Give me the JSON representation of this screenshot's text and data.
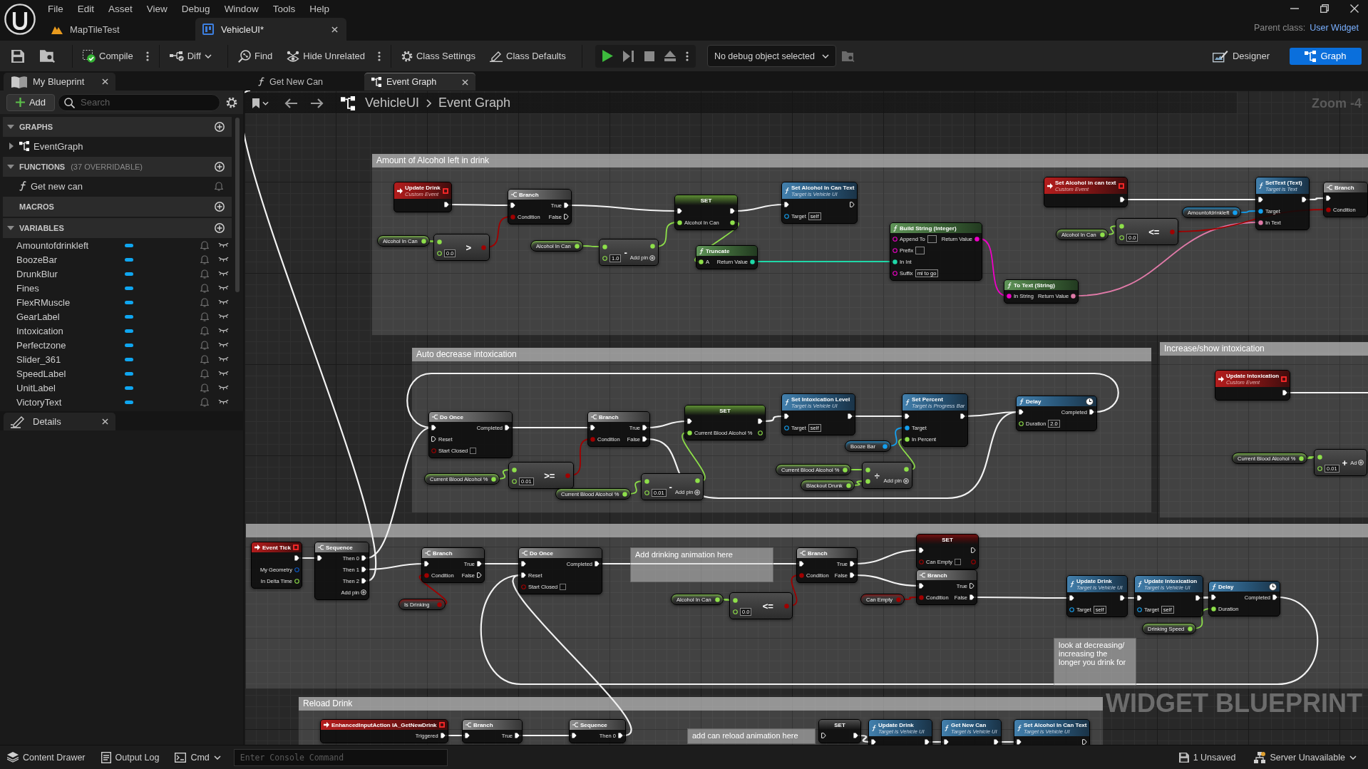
{
  "title_bar": {
    "menu": [
      "File",
      "Edit",
      "Asset",
      "View",
      "Debug",
      "Window",
      "Tools",
      "Help"
    ],
    "tabs": [
      {
        "label": "MapTileTest",
        "kind": "level",
        "selected": false
      },
      {
        "label": "VehicleUI*",
        "kind": "widget",
        "selected": true
      }
    ],
    "parent_class_label": "Parent class:",
    "parent_class": "User Widget"
  },
  "toolbar": {
    "buttons": [
      {
        "kind": "compile",
        "label": "Compile",
        "dropdown": false
      },
      {
        "kind": "diff",
        "label": "Diff",
        "dropdown": true
      },
      {
        "kind": "find",
        "label": "Find",
        "dropdown": false
      },
      {
        "kind": "hide_unrelated",
        "label": "Hide Unrelated",
        "dropdown": false
      },
      {
        "kind": "class_settings",
        "label": "Class Settings",
        "dropdown": false
      },
      {
        "kind": "class_defaults",
        "label": "Class Defaults",
        "dropdown": false
      }
    ],
    "debug_object": "No debug object selected",
    "modes": [
      {
        "kind": "designer",
        "label": "Designer",
        "selected": false
      },
      {
        "kind": "graph",
        "label": "Graph",
        "selected": true
      }
    ]
  },
  "my_blueprint": {
    "tab": "My Blueprint",
    "add": "Add",
    "search_placeholder": "Search",
    "sections": [
      {
        "title": "GRAPHS",
        "expanded": true,
        "items": [
          {
            "label": "EventGraph",
            "kind": "graph",
            "expanded": false
          }
        ]
      },
      {
        "title": "FUNCTIONS",
        "note": "(37 OVERRIDABLE)",
        "expanded": true,
        "items": [
          {
            "label": "Get new can",
            "kind": "function"
          }
        ]
      },
      {
        "title": "MACROS"
      },
      {
        "title": "VARIABLES",
        "expanded": true,
        "items": [
          {
            "label": "Amountofdrinkleft",
            "kind": "variable",
            "public": false
          },
          {
            "label": "BoozeBar",
            "kind": "variable",
            "public": false
          },
          {
            "label": "DrunkBlur",
            "kind": "variable",
            "public": false
          },
          {
            "label": "Fines",
            "kind": "variable",
            "public": false
          },
          {
            "label": "FlexRMuscle",
            "kind": "variable",
            "public": false
          },
          {
            "label": "GearLabel",
            "kind": "variable",
            "public": false
          },
          {
            "label": "Intoxication",
            "kind": "variable",
            "public": false
          },
          {
            "label": "Perfectzone",
            "kind": "variable",
            "public": false
          },
          {
            "label": "Slider_361",
            "kind": "variable",
            "public": false
          },
          {
            "label": "SpeedLabel",
            "kind": "variable",
            "public": false
          },
          {
            "label": "UnitLabel",
            "kind": "variable",
            "public": false
          },
          {
            "label": "VictoryText",
            "kind": "variable",
            "public": false
          }
        ]
      }
    ]
  },
  "details": {
    "tab": "Details"
  },
  "graph_tabs": [
    {
      "label": "Get New Can",
      "kind": "function",
      "selected": false
    },
    {
      "label": "Event Graph",
      "kind": "graph",
      "selected": true
    }
  ],
  "graph": {
    "breadcrumb": [
      "VehicleUI",
      "Event Graph"
    ],
    "zoom": "Zoom -4",
    "watermark": "WIDGET BLUEPRINT",
    "nodes": [
      {
        "kind": "comment",
        "title": "Amount of Alcohol left in drink"
      },
      {
        "kind": "event",
        "title": "Update Drink",
        "subtitle": "Custom Event",
        "outputs": [
          {
            "kind": "exec"
          }
        ]
      },
      {
        "kind": "flow",
        "title": "Branch",
        "inputs": [
          {
            "kind": "exec"
          },
          {
            "kind": "bool",
            "label": "Condition"
          }
        ],
        "outputs": [
          {
            "kind": "exec",
            "label": "True"
          },
          {
            "kind": "exec",
            "label": "False"
          }
        ]
      },
      {
        "kind": "get",
        "title": "Alcohol In Can",
        "outputs": [
          {
            "kind": "float"
          }
        ]
      },
      {
        "kind": "op",
        "title": ">",
        "inputs": [
          {
            "kind": "float"
          },
          {
            "kind": "float",
            "value": "0.0"
          }
        ],
        "outputs": [
          {
            "kind": "bool"
          }
        ]
      },
      {
        "kind": "get",
        "title": "Alcohol In Can",
        "outputs": [
          {
            "kind": "float"
          }
        ]
      },
      {
        "kind": "op",
        "title": "-",
        "inputs": [
          {
            "kind": "float"
          },
          {
            "kind": "float",
            "value": "1.0"
          }
        ],
        "outputs": [
          {
            "kind": "float"
          }
        ],
        "add_pin": "Add pin"
      },
      {
        "kind": "set",
        "title": "SET",
        "inputs": [
          {
            "kind": "exec"
          },
          {
            "kind": "float",
            "label": "Alcohol In Can"
          }
        ],
        "outputs": [
          {
            "kind": "exec"
          },
          {
            "kind": "float"
          }
        ]
      },
      {
        "kind": "pure",
        "title": "Truncate",
        "inputs": [
          {
            "kind": "float",
            "label": "A"
          }
        ],
        "outputs": [
          {
            "kind": "int",
            "label": "Return Value"
          }
        ]
      },
      {
        "kind": "call",
        "title": "Set Alcohol In Can Text",
        "subtitle": "Target is Vehicle UI",
        "inputs": [
          {
            "kind": "exec"
          },
          {
            "kind": "object",
            "label": "Target",
            "value": "self"
          }
        ],
        "outputs": [
          {
            "kind": "exec"
          }
        ]
      },
      {
        "kind": "pure",
        "title": "Build String (Integer)",
        "inputs": [
          {
            "kind": "string",
            "label": "Append To",
            "field": true
          },
          {
            "kind": "string",
            "label": "Prefix",
            "field": true
          },
          {
            "kind": "int",
            "label": "In Int"
          },
          {
            "kind": "string",
            "label": "Suffix",
            "value": "ml to go"
          }
        ],
        "outputs": [
          {
            "kind": "string",
            "label": "Return Value"
          }
        ]
      },
      {
        "kind": "pure",
        "title": "To Text (String)",
        "inputs": [
          {
            "kind": "string",
            "label": "In String"
          }
        ],
        "outputs": [
          {
            "kind": "text",
            "label": "Return Value"
          }
        ]
      },
      {
        "kind": "event",
        "title": "Set Alcohol in can text",
        "subtitle": "Custom Event",
        "outputs": [
          {
            "kind": "exec"
          }
        ]
      },
      {
        "kind": "get",
        "title": "Alcohol In Can",
        "outputs": [
          {
            "kind": "float"
          }
        ]
      },
      {
        "kind": "op",
        "title": "<=",
        "inputs": [
          {
            "kind": "float"
          },
          {
            "kind": "float",
            "value": "0.0"
          }
        ],
        "outputs": [
          {
            "kind": "bool"
          }
        ]
      },
      {
        "kind": "get",
        "title": "Amountofdrinkleft",
        "outputs": [
          {
            "kind": "object"
          }
        ]
      },
      {
        "kind": "call",
        "title": "SetText (Text)",
        "subtitle": "Target is Text",
        "inputs": [
          {
            "kind": "exec"
          },
          {
            "kind": "object",
            "label": "Target"
          },
          {
            "kind": "text",
            "label": "In Text"
          }
        ],
        "outputs": [
          {
            "kind": "exec"
          }
        ]
      },
      {
        "kind": "flow",
        "title": "Branch",
        "inputs": [
          {
            "kind": "exec"
          },
          {
            "kind": "bool",
            "label": "Condition"
          }
        ]
      },
      {
        "kind": "comment",
        "title": "Auto decrease intoxication"
      },
      {
        "kind": "flow",
        "title": "Do Once",
        "inputs": [
          {
            "kind": "exec"
          },
          {
            "kind": "exec",
            "label": "Reset"
          },
          {
            "kind": "bool",
            "label": "Start Closed",
            "checked": false
          }
        ],
        "outputs": [
          {
            "kind": "exec",
            "label": "Completed"
          }
        ]
      },
      {
        "kind": "get",
        "title": "Current Blood Alcohol %",
        "outputs": [
          {
            "kind": "float"
          }
        ]
      },
      {
        "kind": "op",
        "title": ">=",
        "inputs": [
          {
            "kind": "float"
          },
          {
            "kind": "float",
            "value": "0.01"
          }
        ],
        "outputs": [
          {
            "kind": "bool"
          }
        ]
      },
      {
        "kind": "flow",
        "title": "Branch",
        "inputs": [
          {
            "kind": "exec"
          },
          {
            "kind": "bool",
            "label": "Condition"
          }
        ],
        "outputs": [
          {
            "kind": "exec",
            "label": "True"
          },
          {
            "kind": "exec",
            "label": "False"
          }
        ]
      },
      {
        "kind": "get",
        "title": "Current Blood Alcohol %",
        "outputs": [
          {
            "kind": "float"
          }
        ]
      },
      {
        "kind": "op",
        "title": "-",
        "inputs": [
          {
            "kind": "float"
          },
          {
            "kind": "float",
            "value": "0.01"
          }
        ],
        "outputs": [
          {
            "kind": "float"
          }
        ],
        "add_pin": "Add pin"
      },
      {
        "kind": "set",
        "title": "SET",
        "inputs": [
          {
            "kind": "exec"
          },
          {
            "kind": "float",
            "label": "Current Blood Alcohol %"
          }
        ],
        "outputs": [
          {
            "kind": "exec"
          },
          {
            "kind": "float"
          }
        ]
      },
      {
        "kind": "call",
        "title": "Set Intoxication Level",
        "subtitle": "Target is Vehicle UI",
        "inputs": [
          {
            "kind": "exec"
          },
          {
            "kind": "object",
            "label": "Target",
            "value": "self"
          }
        ],
        "outputs": [
          {
            "kind": "exec"
          }
        ]
      },
      {
        "kind": "get",
        "title": "Booze Bar",
        "outputs": [
          {
            "kind": "object"
          }
        ]
      },
      {
        "kind": "call",
        "title": "Set Percent",
        "subtitle": "Target is Progress Bar",
        "inputs": [
          {
            "kind": "exec"
          },
          {
            "kind": "object",
            "label": "Target"
          },
          {
            "kind": "float",
            "label": "In Percent"
          }
        ],
        "outputs": [
          {
            "kind": "exec"
          }
        ]
      },
      {
        "kind": "get",
        "title": "Current Blood Alcohol %",
        "outputs": [
          {
            "kind": "float"
          }
        ]
      },
      {
        "kind": "get",
        "title": "Blackout Drunk",
        "outputs": [
          {
            "kind": "float"
          }
        ]
      },
      {
        "kind": "op",
        "title": "÷",
        "inputs": [
          {
            "kind": "float"
          },
          {
            "kind": "float"
          }
        ],
        "outputs": [
          {
            "kind": "float"
          }
        ],
        "add_pin": "Add pin"
      },
      {
        "kind": "latent",
        "title": "Delay",
        "inputs": [
          {
            "kind": "exec"
          },
          {
            "kind": "float",
            "label": "Duration",
            "value": "2.0"
          }
        ],
        "outputs": [
          {
            "kind": "exec",
            "label": "Completed"
          }
        ]
      },
      {
        "kind": "comment",
        "title": "Increase/show intoxication"
      },
      {
        "kind": "event",
        "title": "Update Intoxication",
        "subtitle": "Custom Event",
        "outputs": [
          {
            "kind": "exec"
          }
        ]
      },
      {
        "kind": "get",
        "title": "Current Blood Alcohol %",
        "outputs": [
          {
            "kind": "float"
          }
        ]
      },
      {
        "kind": "op",
        "title": "+",
        "inputs": [
          {
            "kind": "float"
          },
          {
            "kind": "float",
            "value": "0.01"
          }
        ],
        "add_pin": "Ad"
      },
      {
        "kind": "comment"
      },
      {
        "kind": "event",
        "title": "Event Tick",
        "outputs": [
          {
            "kind": "exec"
          },
          {
            "kind": "struct",
            "label": "My Geometry"
          },
          {
            "kind": "float",
            "label": "In Delta Time"
          }
        ]
      },
      {
        "kind": "flow",
        "title": "Sequence",
        "inputs": [
          {
            "kind": "exec"
          }
        ],
        "outputs": [
          {
            "kind": "exec",
            "label": "Then 0"
          },
          {
            "kind": "exec",
            "label": "Then 1"
          },
          {
            "kind": "exec",
            "label": "Then 2"
          }
        ],
        "add_pin": "Add pin"
      },
      {
        "kind": "flow",
        "title": "Branch",
        "inputs": [
          {
            "kind": "exec"
          },
          {
            "kind": "bool",
            "label": "Condition"
          }
        ],
        "outputs": [
          {
            "kind": "exec",
            "label": "True"
          },
          {
            "kind": "exec",
            "label": "False"
          }
        ]
      },
      {
        "kind": "get",
        "title": "Is Drinking",
        "outputs": [
          {
            "kind": "bool"
          }
        ]
      },
      {
        "kind": "flow",
        "title": "Do Once",
        "inputs": [
          {
            "kind": "exec"
          },
          {
            "kind": "exec",
            "label": "Reset"
          },
          {
            "kind": "bool",
            "label": "Start Closed",
            "checked": false
          }
        ],
        "outputs": [
          {
            "kind": "exec",
            "label": "Completed"
          }
        ]
      },
      {
        "kind": "note",
        "title": "Add drinking animation here"
      },
      {
        "kind": "flow",
        "title": "Branch",
        "inputs": [
          {
            "kind": "exec"
          },
          {
            "kind": "bool",
            "label": "Condition"
          }
        ],
        "outputs": [
          {
            "kind": "exec",
            "label": "True"
          },
          {
            "kind": "exec",
            "label": "False"
          }
        ]
      },
      {
        "kind": "get",
        "title": "Alcohol In Can",
        "outputs": [
          {
            "kind": "float"
          }
        ]
      },
      {
        "kind": "op",
        "title": "<=",
        "inputs": [
          {
            "kind": "float"
          },
          {
            "kind": "float",
            "value": "0.0"
          }
        ],
        "outputs": [
          {
            "kind": "bool"
          }
        ]
      },
      {
        "kind": "set",
        "title": "SET",
        "inputs": [
          {
            "kind": "exec"
          },
          {
            "kind": "bool",
            "label": "Can Empty",
            "checked": false
          }
        ],
        "outputs": [
          {
            "kind": "exec"
          },
          {
            "kind": "bool"
          }
        ]
      },
      {
        "kind": "flow",
        "title": "Branch",
        "inputs": [
          {
            "kind": "exec"
          },
          {
            "kind": "bool",
            "label": "Condition"
          }
        ],
        "outputs": [
          {
            "kind": "exec",
            "label": "True"
          },
          {
            "kind": "exec",
            "label": "False"
          }
        ]
      },
      {
        "kind": "get",
        "title": "Can Empty",
        "outputs": [
          {
            "kind": "bool"
          }
        ]
      },
      {
        "kind": "call",
        "title": "Update Drink",
        "subtitle": "Target is Vehicle UI",
        "inputs": [
          {
            "kind": "exec"
          },
          {
            "kind": "object",
            "label": "Target",
            "value": "self"
          }
        ],
        "outputs": [
          {
            "kind": "exec"
          }
        ]
      },
      {
        "kind": "call",
        "title": "Update Intoxication",
        "subtitle": "Target is Vehicle UI",
        "inputs": [
          {
            "kind": "exec"
          },
          {
            "kind": "object",
            "label": "Target",
            "value": "self"
          }
        ],
        "outputs": [
          {
            "kind": "exec"
          }
        ]
      },
      {
        "kind": "latent",
        "title": "Delay",
        "inputs": [
          {
            "kind": "exec"
          },
          {
            "kind": "float",
            "label": "Duration"
          }
        ],
        "outputs": [
          {
            "kind": "exec",
            "label": "Completed"
          }
        ]
      },
      {
        "kind": "get",
        "title": "Drinking Speed",
        "outputs": [
          {
            "kind": "float"
          }
        ]
      },
      {
        "kind": "note",
        "title": "look at decreasing/ increasing the longer you drink for"
      },
      {
        "kind": "comment",
        "title": "Reload Drink"
      },
      {
        "kind": "event",
        "title": "EnhancedInputAction IA_GetNewDrink",
        "outputs": [
          {
            "kind": "exec",
            "label": "Triggered"
          }
        ]
      },
      {
        "kind": "flow",
        "title": "Branch",
        "inputs": [
          {
            "kind": "exec"
          }
        ],
        "outputs": [
          {
            "kind": "exec",
            "label": "True"
          }
        ]
      },
      {
        "kind": "flow",
        "title": "Sequence",
        "inputs": [
          {
            "kind": "exec"
          }
        ],
        "outputs": [
          {
            "kind": "exec",
            "label": "Then 0"
          }
        ]
      },
      {
        "kind": "note",
        "title": "add can reload animation here"
      },
      {
        "kind": "set",
        "title": "SET",
        "inputs": [
          {
            "kind": "exec"
          }
        ],
        "outputs": [
          {
            "kind": "exec"
          }
        ]
      },
      {
        "kind": "call",
        "title": "Update Drink",
        "subtitle": "Target is Vehicle UI",
        "inputs": [
          {
            "kind": "exec"
          }
        ],
        "outputs": [
          {
            "kind": "exec"
          }
        ]
      },
      {
        "kind": "call",
        "title": "Get New Can",
        "subtitle": "Target is Vehicle UI",
        "inputs": [
          {
            "kind": "exec"
          }
        ],
        "outputs": [
          {
            "kind": "exec"
          }
        ]
      },
      {
        "kind": "call",
        "title": "Set Alcohol In Can Text",
        "subtitle": "Target is Vehicle UI",
        "inputs": [
          {
            "kind": "exec"
          }
        ],
        "outputs": [
          {
            "kind": "exec"
          }
        ]
      }
    ]
  },
  "status_bar": {
    "buttons": [
      {
        "kind": "drawer",
        "label": "Content Drawer",
        "dropdown": false
      },
      {
        "kind": "log",
        "label": "Output Log",
        "dropdown": false
      },
      {
        "kind": "cmd",
        "label": "Cmd",
        "dropdown": true
      }
    ],
    "console_placeholder": "Enter Console Command",
    "indicators": [
      {
        "kind": "unsaved",
        "label": "1 Unsaved",
        "dropdown": false
      },
      {
        "kind": "server",
        "label": "Server Unavailable",
        "dropdown": true
      }
    ]
  }
}
